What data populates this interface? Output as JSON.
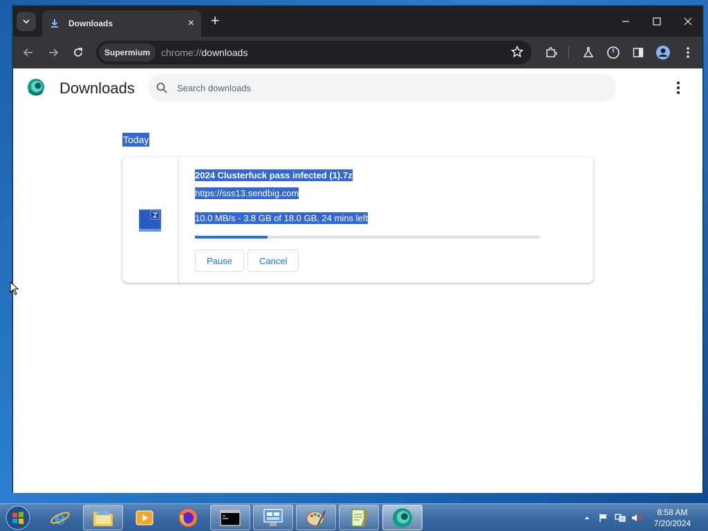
{
  "browser": {
    "tab_title": "Downloads",
    "tab_close_glyph": "×",
    "new_tab_glyph": "+",
    "omnibox_chip": "Supermium",
    "url_scheme": "chrome://",
    "url_path": "downloads",
    "window_controls": {
      "minimize": "—",
      "maximize": "☐",
      "close": "✕"
    }
  },
  "page": {
    "title": "Downloads",
    "search_placeholder": "Search downloads",
    "section_label": "Today"
  },
  "download": {
    "file_name": "2024 Clusterfuck pass infected (1).7z",
    "url": "https://sss13.sendbig.com",
    "status": "10.0 MB/s - 3.8 GB of 18.0 GB, 24 mins left",
    "progress_fraction": 0.211,
    "pause_label": "Pause",
    "cancel_label": "Cancel"
  },
  "taskbar": {
    "time": "8:58 AM",
    "date": "7/20/2024"
  },
  "colors": {
    "highlight": "#3367d6",
    "accent": "#1a73e8",
    "browser_frame": "#202124",
    "toolbar": "#35363a"
  }
}
